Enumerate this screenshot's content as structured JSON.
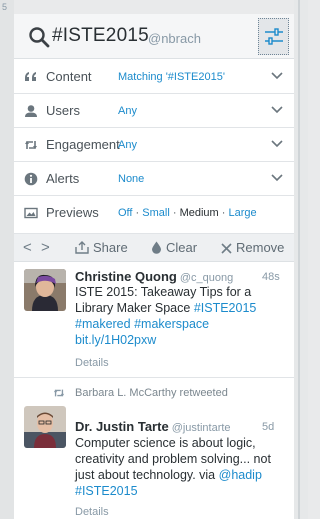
{
  "edge": {
    "left_number": "5"
  },
  "column": {
    "title": "#ISTE2015",
    "subtitle": "@nbrach"
  },
  "options": {
    "content": {
      "label": "Content",
      "value": "Matching '#ISTE2015'"
    },
    "users": {
      "label": "Users",
      "value": "Any"
    },
    "engagement": {
      "label": "Engagement",
      "value": "Any"
    },
    "alerts": {
      "label": "Alerts",
      "value": "None"
    },
    "previews": {
      "label": "Previews",
      "off": "Off",
      "small": "Small",
      "medium": "Medium",
      "large": "Large",
      "sep": "·",
      "selected": "Medium"
    }
  },
  "actions": {
    "prev": "<",
    "next": ">",
    "share": "Share",
    "clear": "Clear",
    "remove": "Remove"
  },
  "tweets": [
    {
      "name": "Christine Quong",
      "handle": "@c_quong",
      "time": "48s",
      "text_1": "ISTE 2015: Takeaway Tips for a Library Maker Space ",
      "link_1": "#ISTE2015",
      "link_2": "#makered",
      "link_3": "#makerspace",
      "link_4": "bit.ly/1H02pxw",
      "details": "Details"
    },
    {
      "retweeted_by": "Barbara L. McCarthy retweeted",
      "name": "Dr. Justin Tarte",
      "handle": "@justintarte",
      "time": "5d",
      "text_1": "Computer science is about logic, creativity and problem solving... not just about technology. via ",
      "link_1": "@hadip",
      "link_2": "#ISTE2015",
      "details": "Details"
    }
  ],
  "colors": {
    "accent": "#1c8bcc",
    "text": "#292f33",
    "muted": "#8899a6",
    "header_bg": "#f5f6f7"
  },
  "icons": {
    "search": "search-icon",
    "settings": "sliders-icon",
    "content": "quote-icon",
    "users": "user-icon",
    "engagement": "retweet-icon",
    "alerts": "info-icon",
    "previews": "image-icon",
    "share": "share-icon",
    "clear": "drop-icon",
    "remove": "close-icon",
    "chevron": "chevron-down-icon"
  }
}
